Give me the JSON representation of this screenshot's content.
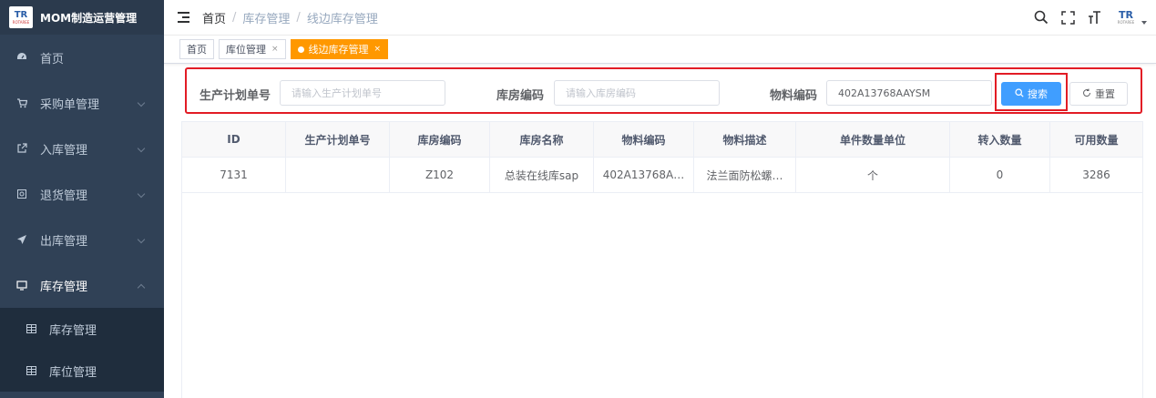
{
  "app": {
    "logo_text": "TR",
    "logo_sub": "ROTAREE",
    "title": "MOM制造运营管理"
  },
  "sidebar": {
    "items": [
      {
        "label": "首页",
        "icon": "dashboard-icon"
      },
      {
        "label": "采购单管理",
        "icon": "cart-icon"
      },
      {
        "label": "入库管理",
        "icon": "external-link-icon"
      },
      {
        "label": "退货管理",
        "icon": "return-icon"
      },
      {
        "label": "出库管理",
        "icon": "send-icon"
      },
      {
        "label": "库存管理",
        "icon": "monitor-icon"
      }
    ],
    "sub_items": [
      {
        "label": "库存管理",
        "icon": "grid-icon"
      },
      {
        "label": "库位管理",
        "icon": "grid-icon"
      }
    ]
  },
  "header": {
    "breadcrumbs": [
      "首页",
      "库存管理",
      "线边库存管理"
    ],
    "icons": [
      "search-icon",
      "fullscreen-icon",
      "font-size-icon"
    ],
    "avatar_text": "TR",
    "avatar_sub": "ROTAREE"
  },
  "tags": [
    {
      "label": "首页",
      "closable": false,
      "active": false
    },
    {
      "label": "库位管理",
      "closable": true,
      "active": false
    },
    {
      "label": "线边库存管理",
      "closable": true,
      "active": true
    }
  ],
  "tag_close": "×",
  "search": {
    "plan_label": "生产计划单号",
    "plan_placeholder": "请输入生产计划单号",
    "warehouse_label": "库房编码",
    "warehouse_placeholder": "请输入库房编码",
    "material_label": "物料编码",
    "material_value": "402A13768AAYSM",
    "search_button": "搜索",
    "reset_button": "重置"
  },
  "table": {
    "columns": [
      "ID",
      "生产计划单号",
      "库房编码",
      "库房名称",
      "物料编码",
      "物料描述",
      "单件数量单位",
      "转入数量",
      "可用数量"
    ],
    "rows": [
      [
        "7131",
        "",
        "Z102",
        "总装在线库sap",
        "402A13768A…",
        "法兰面防松螺…",
        "个",
        "0",
        "3286"
      ]
    ]
  },
  "colors": {
    "sidebar_bg": "#304156",
    "active_tag": "#ff9800",
    "primary": "#409eff",
    "highlight_border": "#e21c25"
  }
}
